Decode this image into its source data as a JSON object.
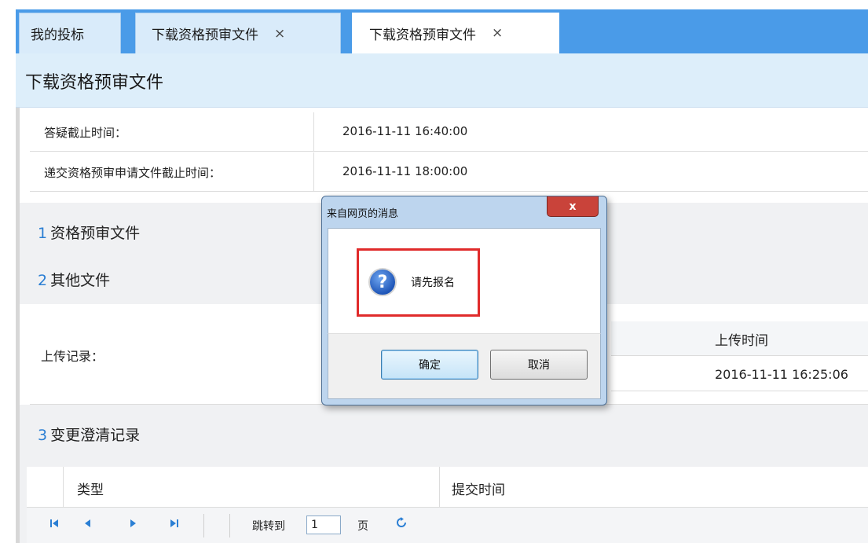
{
  "tabs": [
    {
      "label": "我的投标",
      "closable": false
    },
    {
      "label": "下载资格预审文件",
      "closable": true
    },
    {
      "label": "下载资格预审文件",
      "closable": true,
      "active": true
    }
  ],
  "tab_close_glyph": "×",
  "page_title": "下载资格预审文件",
  "info_rows": [
    {
      "label": "答疑截止时间：",
      "value": "2016-11-11 16:40:00"
    },
    {
      "label": "递交资格预审申请文件截止时间：",
      "value": "2016-11-11 18:00:00"
    }
  ],
  "sections": [
    {
      "num": "1",
      "title": "资格预审文件"
    },
    {
      "num": "2",
      "title": "其他文件"
    },
    {
      "num": "3",
      "title": "变更澄清记录"
    }
  ],
  "upload": {
    "label": "上传记录：",
    "column_header": "上传时间",
    "rows": [
      {
        "time": "2016-11-11 16:25:06"
      }
    ]
  },
  "change_table": {
    "columns": [
      "类型",
      "提交时间"
    ]
  },
  "pager": {
    "jump_label": "跳转到",
    "page_value": "1",
    "page_unit": "页",
    "icons": [
      "first-page-icon",
      "prev-page-icon",
      "next-page-icon",
      "last-page-icon",
      "refresh-icon"
    ]
  },
  "dialog": {
    "title": "来自网页的消息",
    "close_glyph": "x",
    "icon": "question-icon",
    "message": "请先报名",
    "ok_label": "确定",
    "cancel_label": "取消"
  },
  "colors": {
    "tab_strip": "#4a9be8",
    "header_bg": "#ddeefa",
    "section_num": "#2a7ed3",
    "highlight": "#e02b2b",
    "dialog_close": "#c9433a"
  }
}
